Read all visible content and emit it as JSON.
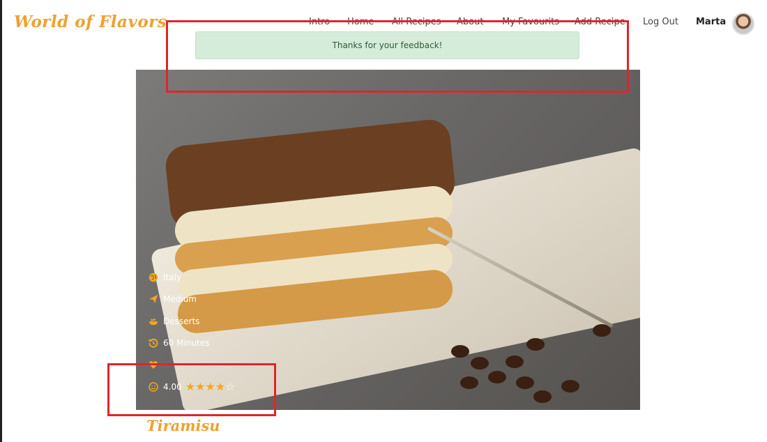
{
  "brand": {
    "logo": "World of Flavors",
    "accent": "#f0a030"
  },
  "nav": {
    "items": [
      "Intro",
      "Home",
      "All Recipes",
      "About",
      "My Favourits",
      "Add Recipe",
      "Log Out"
    ],
    "user": "Marta"
  },
  "flash": {
    "message": "Thanks for your feedback!",
    "color": "#d4ecd9"
  },
  "recipe": {
    "title": "Tiramisu",
    "country": "Italy",
    "difficulty": "Medium",
    "category": "Desserts",
    "time": "60 Minutes",
    "likes": "-",
    "rating": "4.00",
    "rating_value": 4,
    "rating_max": 5
  },
  "icons": [
    "globe-icon",
    "send-icon",
    "bowl-icon",
    "history-icon",
    "heart-icon",
    "smile-icon",
    "star-icon"
  ],
  "highlight_color": "#e0242d"
}
